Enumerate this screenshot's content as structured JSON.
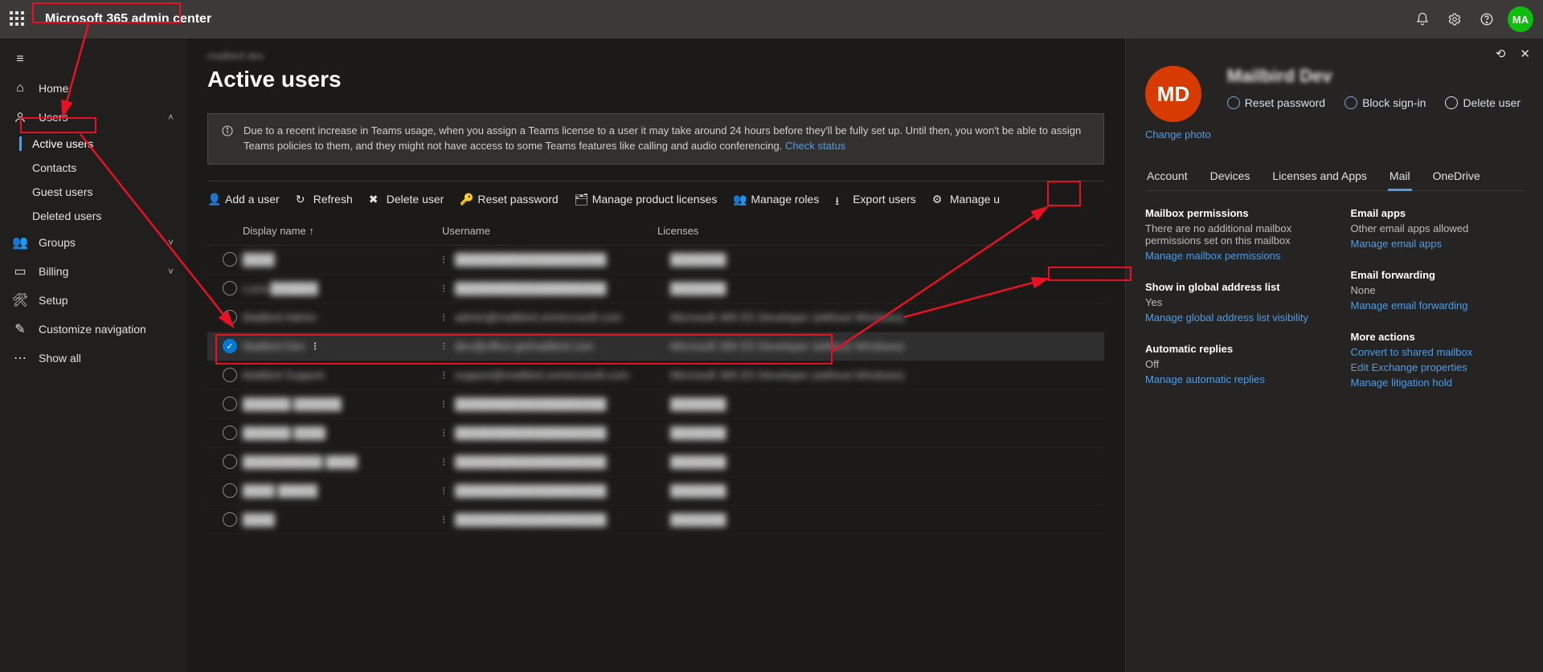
{
  "app_title": "Microsoft 365 admin center",
  "topbar": {
    "avatar_initials": "MA"
  },
  "sidebar": {
    "home": "Home",
    "users": "Users",
    "users_children": [
      "Active users",
      "Contacts",
      "Guest users",
      "Deleted users"
    ],
    "groups": "Groups",
    "billing": "Billing",
    "setup": "Setup",
    "customize": "Customize navigation",
    "show_all": "Show all"
  },
  "main": {
    "breadcrumb": "mailbird dev",
    "page_title": "Active users",
    "banner_text": "Due to a recent increase in Teams usage, when you assign a Teams license to a user it may take around 24 hours before they'll be fully set up. Until then, you won't be able to assign Teams policies to them, and they might not have access to some Teams features like calling and audio conferencing.",
    "banner_link": "Check status",
    "toolbar": {
      "add_user": "Add a user",
      "refresh": "Refresh",
      "delete_user": "Delete user",
      "reset_password": "Reset password",
      "manage_licenses": "Manage product licenses",
      "manage_roles": "Manage roles",
      "export_users": "Export users",
      "manage_username": "Manage u"
    },
    "columns": {
      "display_name": "Display name",
      "username": "Username",
      "licenses": "Licenses"
    },
    "rows": [
      {
        "name": "████",
        "user": "███████████████████",
        "lic": "███████",
        "selected": false
      },
      {
        "name": "Luca ██████",
        "user": "███████████████████",
        "lic": "███████",
        "selected": false
      },
      {
        "name": "Mailbird Admin",
        "user": "admin@mailbird.onmicrosoft.com",
        "lic": "Microsoft 365 E5 Developer (without Windows)",
        "selected": false
      },
      {
        "name": "Mailbird Dev",
        "user": "dev@office.getmailbird.com",
        "lic": "Microsoft 365 E5 Developer (without Windows)",
        "selected": true
      },
      {
        "name": "Mailbird Support",
        "user": "support@mailbird.onmicrosoft.com",
        "lic": "Microsoft 365 E5 Developer (without Windows)",
        "selected": false
      },
      {
        "name": "██████ ██████",
        "user": "███████████████████",
        "lic": "███████",
        "selected": false
      },
      {
        "name": "██████ ████",
        "user": "███████████████████",
        "lic": "███████",
        "selected": false
      },
      {
        "name": "██████████ ████",
        "user": "███████████████████",
        "lic": "███████",
        "selected": false
      },
      {
        "name": "████ █████",
        "user": "███████████████████",
        "lic": "███████",
        "selected": false
      },
      {
        "name": "████",
        "user": "███████████████████",
        "lic": "███████",
        "selected": false
      }
    ]
  },
  "panel": {
    "initials": "MD",
    "name": "Mailbird Dev",
    "change_photo": "Change photo",
    "actions": {
      "reset": "Reset password",
      "block": "Block sign-in",
      "delete": "Delete user"
    },
    "tabs": [
      "Account",
      "Devices",
      "Licenses and Apps",
      "Mail",
      "OneDrive"
    ],
    "active_tab": "Mail",
    "left_sections": [
      {
        "title": "Mailbox permissions",
        "value": "There are no additional mailbox permissions set on this mailbox",
        "links": [
          "Manage mailbox permissions"
        ]
      },
      {
        "title": "Show in global address list",
        "value": "Yes",
        "links": [
          "Manage global address list visibility"
        ]
      },
      {
        "title": "Automatic replies",
        "value": "Off",
        "links": [
          "Manage automatic replies"
        ]
      }
    ],
    "right_sections": [
      {
        "title": "Email apps",
        "value": "Other email apps allowed",
        "links": [
          "Manage email apps"
        ]
      },
      {
        "title": "Email forwarding",
        "value": "None",
        "links": [
          "Manage email forwarding"
        ]
      },
      {
        "title": "More actions",
        "value": "",
        "links": [
          "Convert to shared mailbox",
          "Edit Exchange properties",
          "Manage litigation hold"
        ]
      }
    ]
  }
}
